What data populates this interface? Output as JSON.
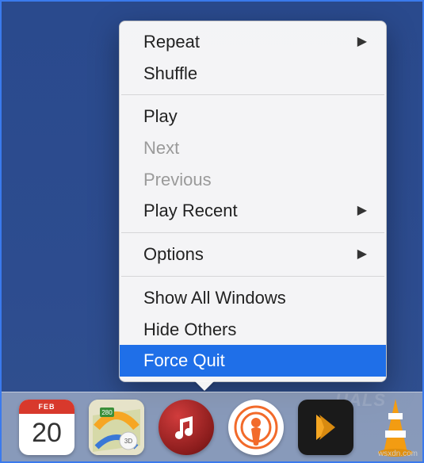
{
  "menu": {
    "sections": [
      [
        {
          "id": "repeat",
          "label": "Repeat",
          "submenu": true,
          "disabled": false
        },
        {
          "id": "shuffle",
          "label": "Shuffle",
          "submenu": false,
          "disabled": false
        }
      ],
      [
        {
          "id": "play",
          "label": "Play",
          "submenu": false,
          "disabled": false
        },
        {
          "id": "next",
          "label": "Next",
          "submenu": false,
          "disabled": true
        },
        {
          "id": "previous",
          "label": "Previous",
          "submenu": false,
          "disabled": true
        },
        {
          "id": "play-recent",
          "label": "Play Recent",
          "submenu": true,
          "disabled": false
        }
      ],
      [
        {
          "id": "options",
          "label": "Options",
          "submenu": true,
          "disabled": false
        }
      ],
      [
        {
          "id": "show-all-windows",
          "label": "Show All Windows",
          "submenu": false,
          "disabled": false
        },
        {
          "id": "hide-others",
          "label": "Hide Others",
          "submenu": false,
          "disabled": false
        },
        {
          "id": "force-quit",
          "label": "Force Quit",
          "submenu": false,
          "disabled": false,
          "selected": true
        }
      ]
    ]
  },
  "dock": {
    "calendar": {
      "month": "FEB",
      "day": "20"
    }
  },
  "watermark": "UALS",
  "attribution": "wsxdn.com"
}
